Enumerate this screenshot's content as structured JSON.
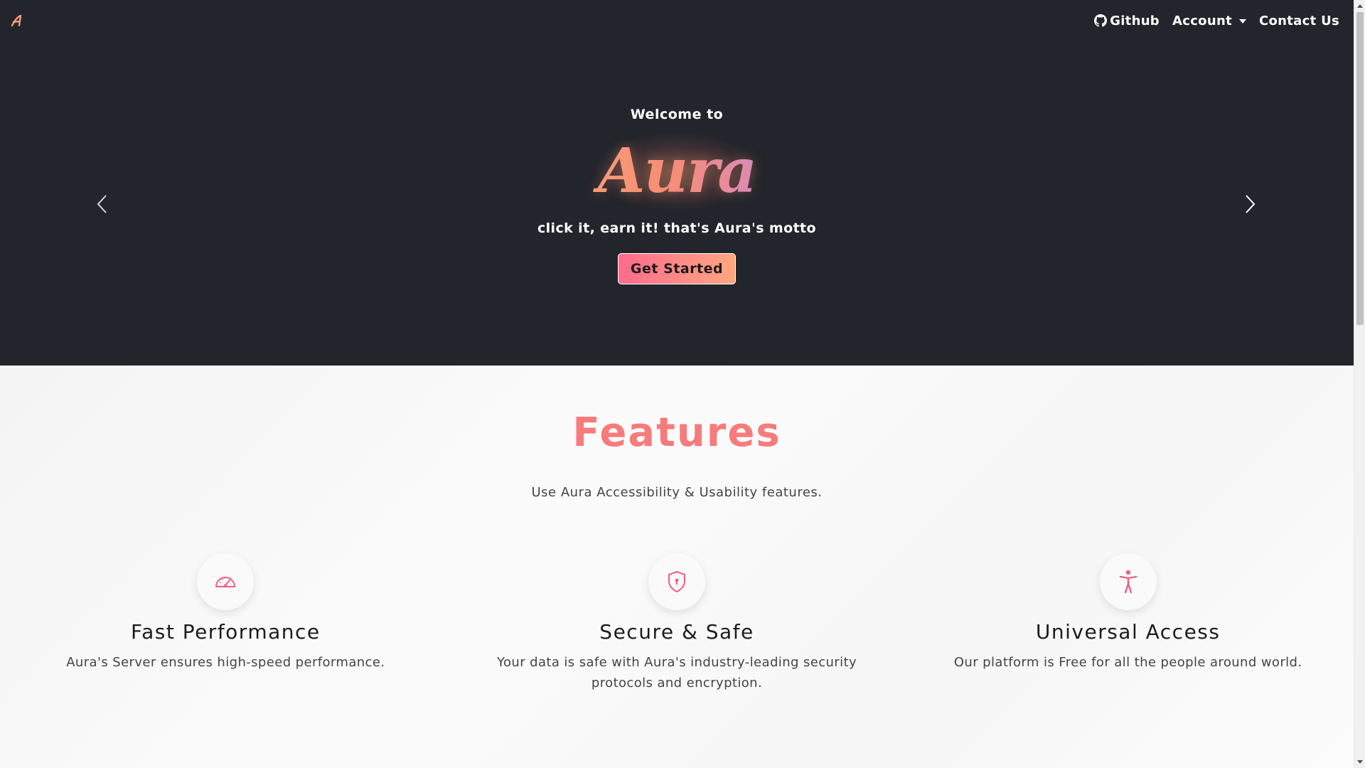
{
  "nav": {
    "brand_icon": "aura-logo-icon",
    "github_label": "Github",
    "github_icon": "github-icon",
    "account_label": "Account",
    "contact_label": "Contact Us"
  },
  "hero": {
    "welcome": "Welcome to",
    "logo_text": "Aura",
    "motto": "click it, earn it! that's Aura's motto",
    "cta_label": "Get Started",
    "prev_icon": "chevron-left-icon",
    "next_icon": "chevron-right-icon"
  },
  "features": {
    "title": "Features",
    "subtitle": "Use Aura Accessibility & Usability features.",
    "cards": [
      {
        "icon": "speedometer-icon",
        "title": "Fast Performance",
        "desc": "Aura's Server ensures high-speed performance."
      },
      {
        "icon": "shield-lock-icon",
        "title": "Secure & Safe",
        "desc": "Your data is safe with Aura's industry-leading security protocols and encryption."
      },
      {
        "icon": "universal-access-icon",
        "title": "Universal Access",
        "desc": "Our platform is Free for all the people around world."
      }
    ]
  },
  "colors": {
    "nav_bg": "#22252b",
    "accent": "#f77b7b",
    "cta_gradient_start": "#ff6b8b",
    "cta_gradient_end": "#ffa77e",
    "icon_pink": "#f0607f"
  }
}
